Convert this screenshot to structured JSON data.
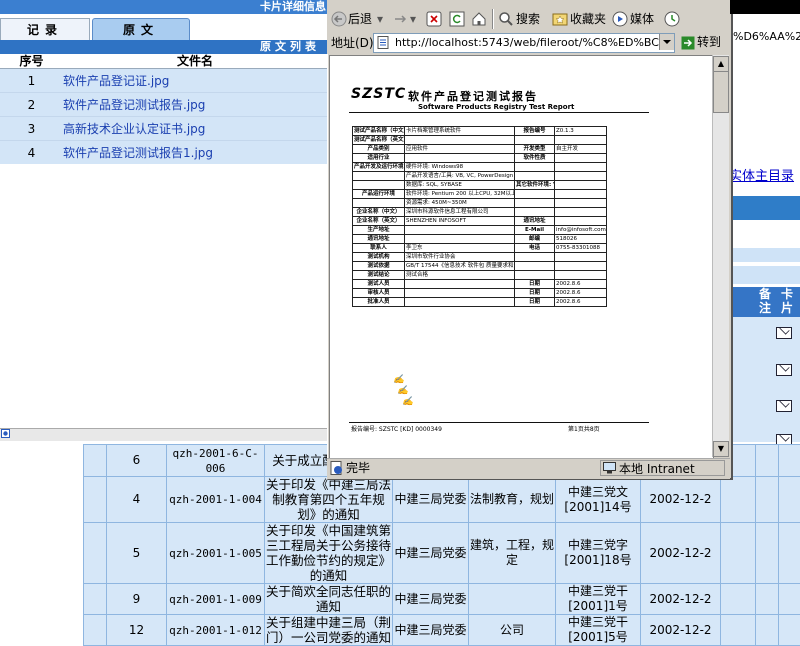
{
  "background_page": {
    "banner_title": "卡片详细信息",
    "right_link": "实体主目录",
    "header_cols": [
      "备注",
      "卡片"
    ],
    "rows": [
      {
        "seq": "6",
        "code": "qzh-2001-6-C-006",
        "title": "关于成立配工作领导",
        "org": "",
        "keywords": "",
        "docnum": "",
        "date": ""
      },
      {
        "seq": "4",
        "code": "qzh-2001-1-004",
        "title": "关于印发《中建三局法制教育第四个五年规划》的通知",
        "org": "中建三局党委",
        "keywords": "法制教育，规划",
        "docnum": "中建三党文[2001]14号",
        "date": "2002-12-2"
      },
      {
        "seq": "5",
        "code": "qzh-2001-1-005",
        "title": "关于印发《中国建筑第三工程局关于公务接待工作勤俭节约的规定》的通知",
        "org": "中建三局党委",
        "keywords": "建筑，工程，规定",
        "docnum": "中建三党字[2001]18号",
        "date": "2002-12-2"
      },
      {
        "seq": "9",
        "code": "qzh-2001-1-009",
        "title": "关于简欢全同志任职的通知",
        "org": "中建三局党委",
        "keywords": "",
        "docnum": "中建三党干[2001]1号",
        "date": "2002-12-2"
      },
      {
        "seq": "12",
        "code": "qzh-2001-1-012",
        "title": "关于组建中建三局（荆门）一公司党委的通知",
        "org": "中建三局党委",
        "keywords": "公司",
        "docnum": "中建三党干[2001]5号",
        "date": "2002-12-2"
      }
    ]
  },
  "card_window": {
    "tabs": [
      "记录",
      "原文"
    ],
    "list_header": "原文列表",
    "columns": [
      "序号",
      "文件名"
    ],
    "files": [
      {
        "num": "1",
        "name": "软件产品登记证.jpg"
      },
      {
        "num": "2",
        "name": "软件产品登记测试报告.jpg"
      },
      {
        "num": "3",
        "name": "高新技术企业认定证书.jpg"
      },
      {
        "num": "4",
        "name": "软件产品登记测试报告1.jpg"
      }
    ]
  },
  "ie_window": {
    "toolbar": {
      "back": "后退",
      "search": "搜索",
      "favorites": "收藏夹",
      "media": "媒体"
    },
    "address_label": "地址(D)",
    "address_value": "http://localhost:5743/web/fileroot/%C8%ED%BC%FE%B2%",
    "address_tail": "%D6%AA%25",
    "go_label": "转到",
    "status_text": "完毕",
    "zone_text": "本地 Intranet"
  },
  "report": {
    "logo": "SZSTC",
    "title": "软件产品登记测试报告",
    "title_en": "Software Products Registry Test Report",
    "footer_left": "报告编号: SZSTC [KD] 0000349",
    "footer_right": "第1页共8页",
    "fields": [
      [
        "测试产品名称（中文）",
        "卡片档案管理系统软件",
        "报告编号",
        "Z0.1.3"
      ],
      [
        "测试产品名称（英文）",
        "",
        "",
        ""
      ],
      [
        "产品类别",
        "应用软件",
        "开发类型",
        "自主开发"
      ],
      [
        "适用行业",
        "",
        "软件性质",
        ""
      ],
      [
        "产品开发及运行环境",
        "硬件环境: Windows98",
        "",
        ""
      ],
      [
        "",
        "产品开发语言/工具: VB, VC, PowerDesign",
        "",
        ""
      ],
      [
        "",
        "数据库: SQL, SYBASE",
        "其它软件环境: Visual SourceSafe",
        ""
      ],
      [
        "产品运行环境",
        "软件环境: Pentium 200 以上CPU, 32M以上内存",
        "",
        ""
      ],
      [
        "",
        "资源需求: 450M~350M",
        "",
        ""
      ],
      [
        "企业名称（中文）",
        "深圳市科源软件信息工程有限公司",
        "",
        ""
      ],
      [
        "企业名称（英文）",
        "SHENZHEN INFOSOFT",
        "通讯地址",
        ""
      ],
      [
        "生产地址",
        "",
        "E-Mail",
        "info@infosoft.com.cn"
      ],
      [
        "通讯地址",
        "",
        "邮编",
        "518026"
      ],
      [
        "联系人",
        "李卫东",
        "电话",
        "0755-83301088"
      ],
      [
        "测试机构",
        "深圳市软件行业协会",
        "",
        ""
      ],
      [
        "测试依据",
        "GB/T 17544《信息技术 软件包 质量要求和测试》",
        "",
        ""
      ],
      [
        "测试结论",
        "测试合格",
        "",
        ""
      ],
      [
        "测试人员",
        "",
        "日期",
        "2002.8.6"
      ],
      [
        "审核人员",
        "",
        "日期",
        "2002.8.6"
      ],
      [
        "批准人员",
        "",
        "日期",
        "2002.8.6"
      ]
    ]
  }
}
